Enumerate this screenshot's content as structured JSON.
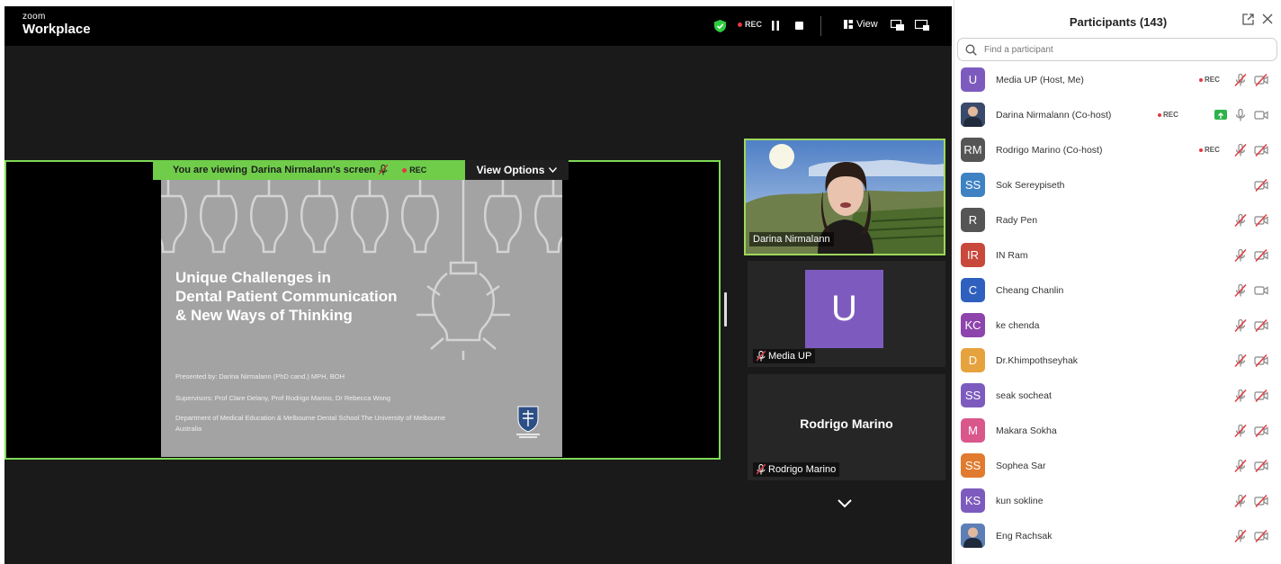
{
  "app": {
    "brand_small": "zoom",
    "brand_big": "Workplace",
    "rec_label": "REC",
    "view_label": "View"
  },
  "share": {
    "banner_prefix": "You are viewing",
    "banner_name": "Darina Nirmalann's screen",
    "banner_rec": "REC",
    "view_options_label": "View Options"
  },
  "slide": {
    "title_lines": [
      "Unique Challenges in",
      "Dental Patient Communication",
      "& New Ways of Thinking"
    ],
    "presented_by": "Presented by: Darina Nirmalann (PhD cand.) MPH, BOH",
    "supervisors": "Supervisors: Prof Clare Delany, Prof Rodrigo Marino, Dr Rebecca Wong",
    "department_line1": "Department of Medical Education & Melbourne Dental School The University of Melbourne",
    "department_line2": "Australia"
  },
  "tiles": {
    "darina_label": "Darina Nirmalann",
    "media_avatar": "U",
    "media_label": "Media UP",
    "rodrigo_big": "Rodrigo Marino",
    "rodrigo_label": "Rodrigo Marino"
  },
  "panel": {
    "title": "Participants (143)",
    "search_placeholder": "Find a participant",
    "rec_label": "REC",
    "participants": [
      {
        "initials": "U",
        "name": "Media UP (Host, Me)",
        "color": "#7d5bbe",
        "rec": true,
        "mic": "muted",
        "video": "off",
        "photo": false
      },
      {
        "initials": "",
        "name": "Darina Nirmalann (Co-host)",
        "color": "#3b4a6b",
        "rec": true,
        "share": true,
        "mic": "on",
        "video": "on",
        "photo": true
      },
      {
        "initials": "RM",
        "name": "Rodrigo Marino (Co-host)",
        "color": "#555555",
        "rec": true,
        "mic": "muted",
        "video": "off",
        "photo": false
      },
      {
        "initials": "SS",
        "name": "Sok Sereypiseth",
        "color": "#3e82c3",
        "rec": false,
        "mic": "none",
        "video": "off",
        "photo": false
      },
      {
        "initials": "R",
        "name": "Rady Pen",
        "color": "#555555",
        "rec": false,
        "mic": "muted",
        "video": "off",
        "photo": false
      },
      {
        "initials": "IR",
        "name": "IN Ram",
        "color": "#c8483b",
        "rec": false,
        "mic": "muted",
        "video": "off",
        "photo": false
      },
      {
        "initials": "C",
        "name": "Cheang Chanlin",
        "color": "#2f5fbf",
        "rec": false,
        "mic": "muted",
        "video": "on",
        "photo": false
      },
      {
        "initials": "KC",
        "name": "ke chenda",
        "color": "#8e44ad",
        "rec": false,
        "mic": "muted",
        "video": "off",
        "photo": false
      },
      {
        "initials": "D",
        "name": "Dr.Khimpothseyhak",
        "color": "#e6a23c",
        "rec": false,
        "mic": "muted",
        "video": "off",
        "photo": false
      },
      {
        "initials": "SS",
        "name": "seak socheat",
        "color": "#7d5bbe",
        "rec": false,
        "mic": "muted",
        "video": "off",
        "photo": false
      },
      {
        "initials": "M",
        "name": "Makara Sokha",
        "color": "#d9578b",
        "rec": false,
        "mic": "muted",
        "video": "off",
        "photo": false
      },
      {
        "initials": "SS",
        "name": "Sophea Sar",
        "color": "#e07b2f",
        "rec": false,
        "mic": "muted",
        "video": "off",
        "photo": false
      },
      {
        "initials": "KS",
        "name": "kun sokline",
        "color": "#7d5bbe",
        "rec": false,
        "mic": "muted",
        "video": "off",
        "photo": false
      },
      {
        "initials": "",
        "name": "Eng Rachsak",
        "color": "#5d7fb5",
        "rec": false,
        "mic": "muted",
        "video": "off",
        "photo": true
      }
    ]
  }
}
